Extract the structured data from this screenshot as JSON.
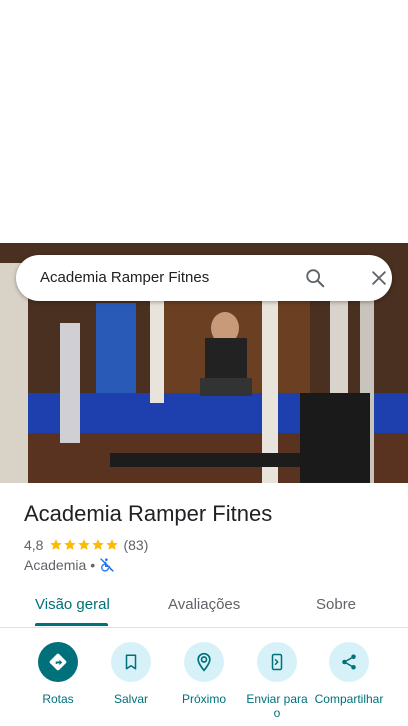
{
  "search": {
    "query": "Academia Ramper Fitnes"
  },
  "place": {
    "name": "Academia Ramper Fitnes",
    "rating": "4,8",
    "stars": 5,
    "review_count": "(83)",
    "category": "Academia",
    "separator": "•"
  },
  "tabs": [
    {
      "label": "Visão geral",
      "active": true
    },
    {
      "label": "Avaliações",
      "active": false
    },
    {
      "label": "Sobre",
      "active": false
    }
  ],
  "actions": [
    {
      "label": "Rotas",
      "icon": "directions-icon"
    },
    {
      "label": "Salvar",
      "icon": "bookmark-icon"
    },
    {
      "label": "Próximo",
      "icon": "nearby-icon"
    },
    {
      "label": "Enviar para o",
      "icon": "send-to-phone-icon"
    },
    {
      "label": "Compartilhar",
      "icon": "share-icon"
    }
  ],
  "colors": {
    "accent": "#00707a",
    "chip": "#d6f1f7",
    "star": "#fbbc04"
  }
}
